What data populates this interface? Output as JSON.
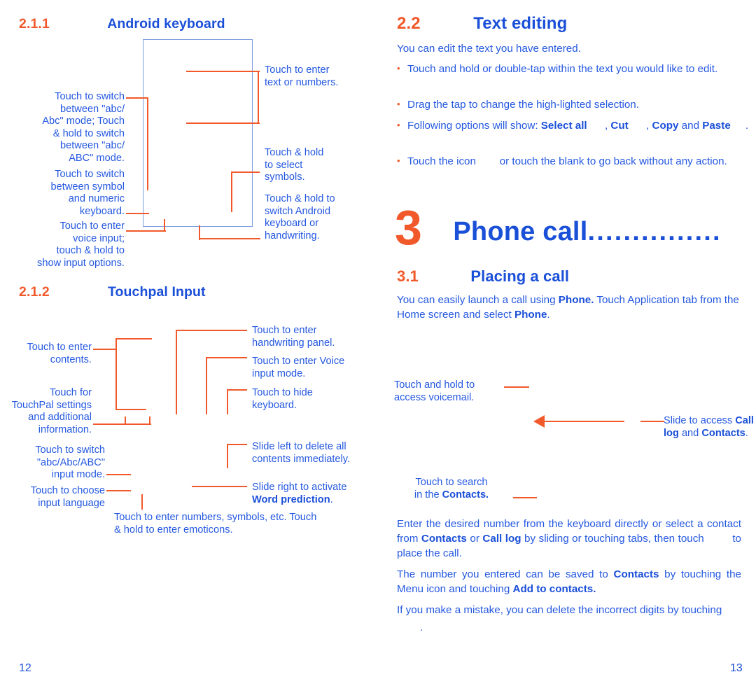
{
  "colors": {
    "accent_orange": "#f1592a",
    "heading_blue": "#1a4fd8",
    "body_blue": "#2458e0",
    "screen_border_blue": "#7a9ae0"
  },
  "left_page": {
    "folio": "12",
    "section_211": {
      "number": "2.1.1",
      "title": "Android keyboard",
      "callouts": {
        "enter_text": "Touch to enter\ntext or numbers.",
        "switch_abc": "Touch to switch\nbetween \"abc/\nAbc\" mode; Touch\n& hold to switch\nbetween \"abc/\nABC\" mode.",
        "switch_symbol": "Touch to switch\nbetween symbol\nand numeric\nkeyboard.",
        "voice_input": "Touch to enter\nvoice input;\ntouch & hold to\nshow input options.",
        "select_symbols": "Touch & hold\nto select\nsymbols.",
        "switch_android": "Touch & hold to\nswitch Android\nkeyboard or\nhandwriting."
      }
    },
    "section_212": {
      "number": "2.1.2",
      "title": "Touchpal Input",
      "callouts": {
        "enter_contents": "Touch to enter\ncontents.",
        "touchpal_settings": "Touch for\nTouchPal settings\nand additional\ninformation.",
        "switch_mode": "Touch to switch\n\"abc/Abc/ABC\"\ninput mode.",
        "choose_language": "Touch to choose\ninput language",
        "handwriting_panel": "Touch to enter\nhandwriting panel.",
        "voice_input_mode": "Touch to enter Voice\ninput mode.",
        "hide_keyboard": "Touch to hide\nkeyboard.",
        "slide_left_delete": "Slide left to delete all\ncontents immediately.",
        "slide_right_word_prediction_pre": "Slide right to activate\n",
        "slide_right_word_prediction_bold": "Word prediction",
        "slide_right_word_prediction_post": ".",
        "numbers_symbols": "Touch to enter numbers, symbols, etc. Touch\n& hold to enter emoticons."
      }
    }
  },
  "right_page": {
    "folio": "13",
    "section_22": {
      "number": "2.2",
      "title": "Text editing",
      "intro": "You can edit the text you have entered.",
      "bullets": [
        {
          "parts": [
            {
              "text": "Touch and hold or double-tap within the text you would like to edit.",
              "bold": false
            }
          ]
        },
        {
          "parts": [
            {
              "text": "Drag the tap to change the high-lighted selection.",
              "bold": false
            }
          ]
        },
        {
          "parts": [
            {
              "text": "Following options will show: ",
              "bold": false
            },
            {
              "text": "Select all",
              "bold": true
            },
            {
              "text": "      , ",
              "bold": false
            },
            {
              "text": "Cut",
              "bold": true
            },
            {
              "text": "      , ",
              "bold": false
            },
            {
              "text": "Copy",
              "bold": true
            },
            {
              "text": " and ",
              "bold": false
            },
            {
              "text": "Paste",
              "bold": true
            },
            {
              "text": "     .",
              "bold": false
            }
          ]
        },
        {
          "parts": [
            {
              "text": "Touch the icon        or touch the blank to go back without any action.",
              "bold": false
            }
          ]
        }
      ]
    },
    "chapter_3": {
      "number": "3",
      "title": "Phone call",
      "dots": "...............",
      "section_31": {
        "number": "3.1",
        "title": "Placing a call",
        "paragraph_parts": [
          {
            "text": "You can easily launch a call using ",
            "bold": false
          },
          {
            "text": "Phone.",
            "bold": true
          },
          {
            "text": " Touch Application tab from the Home screen and select ",
            "bold": false
          },
          {
            "text": "Phone",
            "bold": true
          },
          {
            "text": ".",
            "bold": false
          }
        ]
      }
    },
    "callouts": {
      "voicemail": "Touch and hold to\naccess voicemail.",
      "slide_access_pre": "Slide to access ",
      "slide_access_bold1": "Call log",
      "slide_access_mid": " and ",
      "slide_access_bold2": "Contacts",
      "slide_access_post": ".",
      "search_contacts_pre": "Touch to search\nin the ",
      "search_contacts_bold": "Contacts.",
      "search_line1": "Touch to search",
      "search_line2_pre": "in the ",
      "search_line2_bold": "Contacts."
    },
    "paragraphs": [
      {
        "parts": [
          {
            "text": "Enter the desired number from the keyboard directly or select a contact from ",
            "bold": false
          },
          {
            "text": "Contacts",
            "bold": true
          },
          {
            "text": " or ",
            "bold": false
          },
          {
            "text": "Call log",
            "bold": true
          },
          {
            "text": " by sliding or touching tabs, then touch         to place the call.",
            "bold": false
          }
        ]
      },
      {
        "parts": [
          {
            "text": "The number you entered can be saved to ",
            "bold": false
          },
          {
            "text": "Contacts",
            "bold": true
          },
          {
            "text": " by touching the Menu icon and touching ",
            "bold": false
          },
          {
            "text": "Add to contacts.",
            "bold": true
          }
        ]
      },
      {
        "parts": [
          {
            "text": "If you make a mistake, you can delete the incorrect digits by touching",
            "bold": false
          }
        ]
      },
      {
        "parts": [
          {
            "text": ".",
            "bold": false
          }
        ]
      }
    ]
  }
}
